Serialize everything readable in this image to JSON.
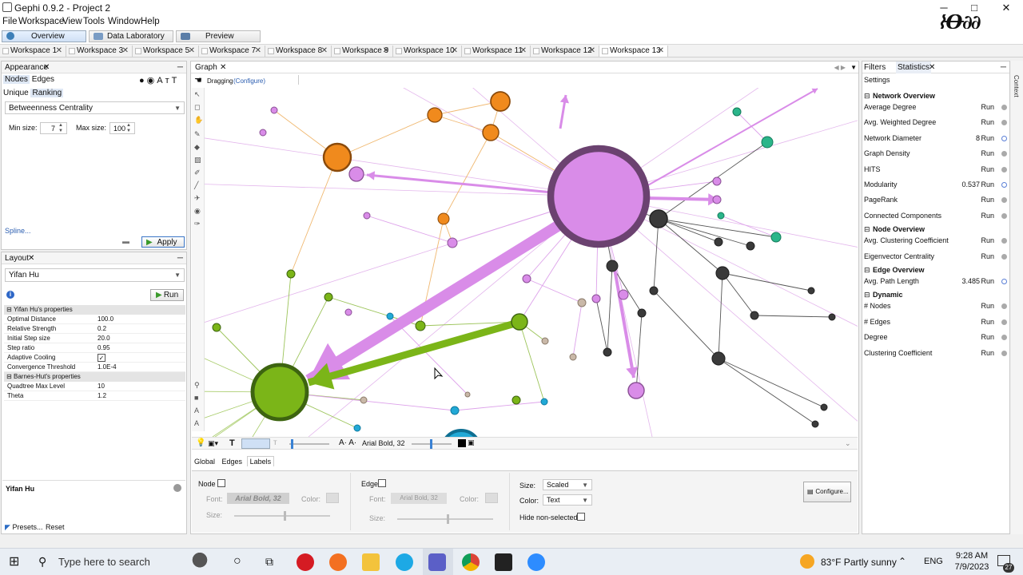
{
  "window": {
    "title": "Gephi 0.9.2 - Project 2",
    "minimize": "─",
    "maximize": "□",
    "close": "✕"
  },
  "menu": [
    "File",
    "Workspace",
    "View",
    "Tools",
    "Window",
    "Help"
  ],
  "perspectives": [
    "Overview",
    "Data Laboratory",
    "Preview"
  ],
  "workspaces": [
    "Workspace 1",
    "Workspace 3",
    "Workspace 5",
    "Workspace 7",
    "Workspace 8",
    "Workspace 9",
    "Workspace 10",
    "Workspace 11",
    "Workspace 12",
    "Workspace 13"
  ],
  "tab_close": "✕",
  "appearance": {
    "title": "Appearance",
    "tabs": [
      "Nodes",
      "Edges"
    ],
    "subtabs": [
      "Unique",
      "Ranking"
    ],
    "attribute": "Betweenness Centrality",
    "min_label": "Min size:",
    "min_value": "7",
    "max_label": "Max size:",
    "max_value": "100",
    "spline": "Spline...",
    "apply": "Apply"
  },
  "layout": {
    "title": "Layout",
    "algorithm": "Yifan Hu",
    "run": "Run",
    "section1": "Yifan Hu's properties",
    "props1": [
      {
        "k": "Optimal Distance",
        "v": "100.0"
      },
      {
        "k": "Relative Strength",
        "v": "0.2"
      },
      {
        "k": "Initial Step size",
        "v": "20.0"
      },
      {
        "k": "Step ratio",
        "v": "0.95"
      },
      {
        "k": "Adaptive Cooling",
        "v": "✓"
      },
      {
        "k": "Convergence Threshold",
        "v": "1.0E-4"
      }
    ],
    "section2": "Barnes-Hut's properties",
    "props2": [
      {
        "k": "Quadtree Max Level",
        "v": "10"
      },
      {
        "k": "Theta",
        "v": "1.2"
      }
    ],
    "footer_name": "Yifan Hu",
    "presets": "Presets...",
    "reset": "Reset"
  },
  "graph": {
    "tab": "Graph",
    "mode": "Dragging",
    "configure": "(Configure)",
    "font_label": "Arial Bold, 32",
    "bottom_tabs": [
      "Global",
      "Edges",
      "Labels"
    ],
    "node_label": "Node",
    "edge_label": "Edge",
    "font_field": "Font:",
    "font_value": "Arial Bold, 32",
    "color_field": "Color:",
    "size_field": "Size:",
    "size_select": "Scaled",
    "color_select": "Text",
    "hide_nonselected": "Hide non-selected",
    "configure_btn": "Configure..."
  },
  "stats": {
    "filters_tab": "Filters",
    "stats_tab": "Statistics",
    "settings": "Settings",
    "side_label": "Context",
    "network_overview": "Network Overview",
    "node_overview": "Node Overview",
    "edge_overview": "Edge Overview",
    "dynamic": "Dynamic",
    "run": "Run",
    "rows_network": [
      {
        "name": "Average Degree",
        "value": ""
      },
      {
        "name": "Avg. Weighted Degree",
        "value": ""
      },
      {
        "name": "Network Diameter",
        "value": "8"
      },
      {
        "name": "Graph Density",
        "value": ""
      },
      {
        "name": "HITS",
        "value": ""
      },
      {
        "name": "Modularity",
        "value": "0.537"
      },
      {
        "name": "PageRank",
        "value": ""
      },
      {
        "name": "Connected Components",
        "value": ""
      }
    ],
    "rows_node": [
      {
        "name": "Avg. Clustering Coefficient",
        "value": ""
      },
      {
        "name": "Eigenvector Centrality",
        "value": ""
      }
    ],
    "rows_edge": [
      {
        "name": "Avg. Path Length",
        "value": "3.485"
      }
    ],
    "rows_dynamic": [
      {
        "name": "# Nodes",
        "value": ""
      },
      {
        "name": "# Edges",
        "value": ""
      },
      {
        "name": "Degree",
        "value": ""
      },
      {
        "name": "Clustering Coefficient",
        "value": ""
      }
    ]
  },
  "taskbar": {
    "search_placeholder": "Type here to search",
    "weather": "83°F  Partly sunny",
    "lang": "ENG",
    "time": "9:28 AM",
    "date": "7/9/2023",
    "notifications": "27"
  },
  "colors": {
    "pink": "#d98ce8",
    "orange": "#f08a1d",
    "green": "#7bb518",
    "dark": "#3a3a3a",
    "teal": "#2bb58a",
    "cyan": "#22a9d6"
  }
}
